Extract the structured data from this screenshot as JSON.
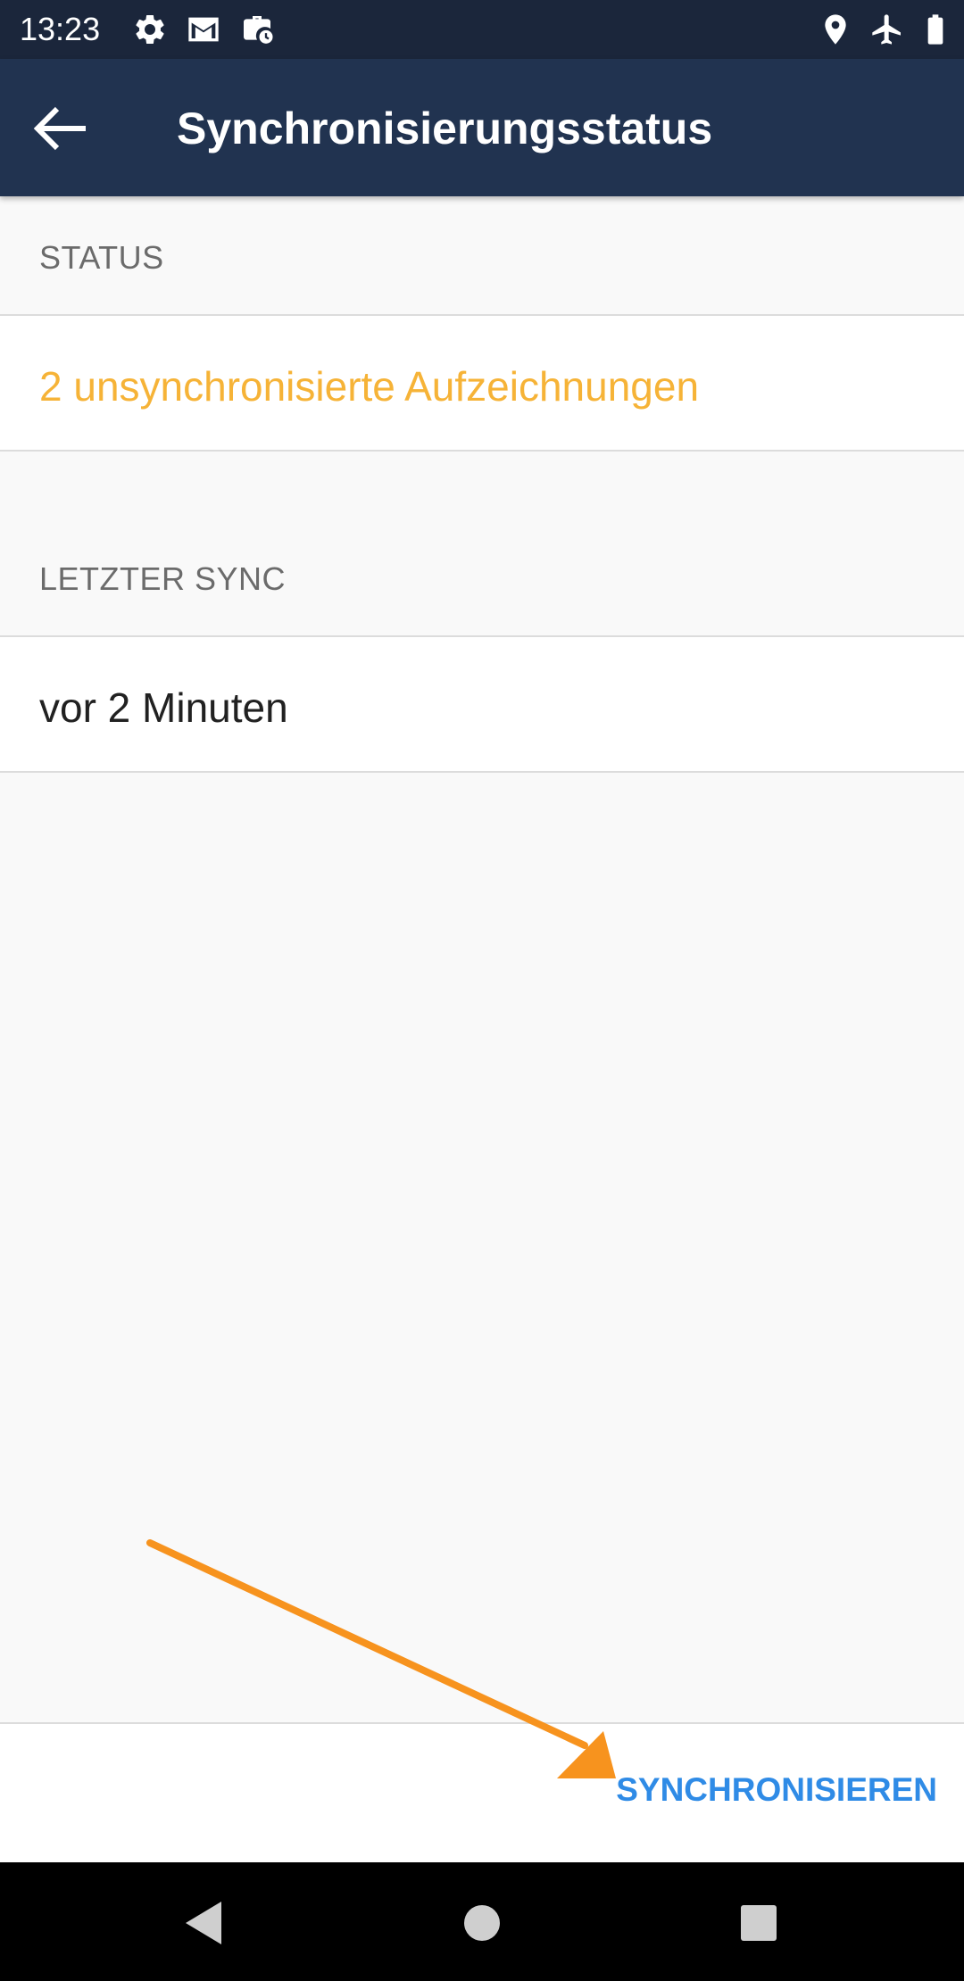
{
  "status_bar": {
    "time": "13:23",
    "left_icons": [
      "gear-icon",
      "gmail-icon",
      "work-schedule-icon"
    ],
    "right_icons": [
      "location-icon",
      "airplane-icon",
      "battery-icon"
    ]
  },
  "app_bar": {
    "back_icon": "arrow-back-icon",
    "title": "Synchronisierungsstatus"
  },
  "sections": {
    "status": {
      "header": "STATUS",
      "value": "2 unsynchronisierte Aufzeichnungen"
    },
    "last_sync": {
      "header": "LETZTER SYNC",
      "value": "vor 2 Minuten"
    }
  },
  "bottom_bar": {
    "sync_button_label": "SYNCHRONISIEREN"
  },
  "annotation": {
    "arrow_icon": "pointer-arrow"
  },
  "nav_bar": {
    "icons": [
      "nav-back-icon",
      "nav-home-icon",
      "nav-recents-icon"
    ]
  },
  "colors": {
    "status_bar": "#1b263b",
    "app_bar": "#213350",
    "warning_text": "#f6b337",
    "accent": "#2f8be6",
    "annotation_arrow": "#f7931e"
  }
}
